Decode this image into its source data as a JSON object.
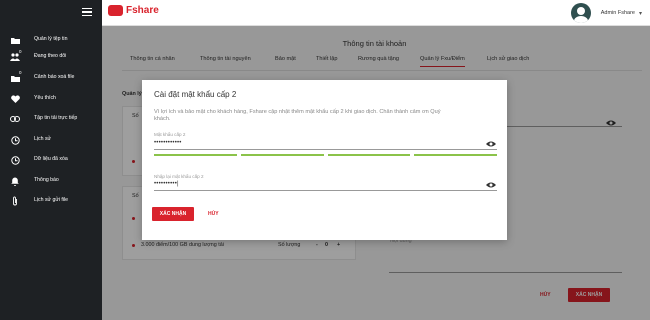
{
  "sidebar": {
    "items": [
      {
        "label": "Quản lý tệp tin",
        "icon": "folder-icon",
        "badge": ""
      },
      {
        "label": "Đang theo dõi",
        "icon": "people-icon",
        "badge": "0"
      },
      {
        "label": "Cảnh báo xoá file",
        "icon": "folder-warning-icon",
        "badge": "0"
      },
      {
        "label": "Yêu thích",
        "icon": "heart-icon",
        "badge": ""
      },
      {
        "label": "Tập tin tải trực tiếp",
        "icon": "link-icon",
        "badge": ""
      },
      {
        "label": "Lịch sử",
        "icon": "history-icon",
        "badge": ""
      },
      {
        "label": "Dữ liệu đã xóa",
        "icon": "trash-icon",
        "badge": ""
      },
      {
        "label": "Thông báo",
        "icon": "bell-icon",
        "badge": ""
      },
      {
        "label": "Lịch sử gửi file",
        "icon": "paperclip-icon",
        "badge": ""
      }
    ]
  },
  "header": {
    "logo": "Fshare",
    "user_name": "Admin Fshare",
    "avatar_caption": "Fshare"
  },
  "page": {
    "title": "Thông tin tài khoản",
    "tabs": [
      "Thông tin cá nhân",
      "Thông tin tài nguyên",
      "Bảo mật",
      "Thiết lập",
      "Rương quà tặng",
      "Quản lý Fxu/Điểm",
      "Lịch sử giao dịch"
    ],
    "active_tab": 5
  },
  "background": {
    "left_heading": "Quản lý",
    "row1_prefix": "Số",
    "row2_prefix": "Số",
    "item_text": "3.000 điểm/100 GB dung lượng tải",
    "quantity_label": "Số lượng",
    "quantity_value": "0",
    "minus": "-",
    "plus": "+",
    "notes_placeholder": "Nội dung",
    "cancel": "HỦY",
    "confirm": "XÁC NHẬN"
  },
  "modal": {
    "title": "Cài đặt mật khẩu cấp 2",
    "description": "Vì lợi ích và bảo mật cho khách hàng, Fshare cập nhật thêm mật khẩu cấp 2 khi giao dịch. Chân thành cảm ơn Quý khách.",
    "password_label": "Mật khẩu cấp 2",
    "password_value": "••••••••••••",
    "confirm_label": "Nhập lại mật khẩu cấp 2",
    "confirm_value": "••••••••••|",
    "confirm_button": "XÁC NHẬN",
    "cancel_button": "HỦY",
    "strength_fraction": 1.0
  },
  "colors": {
    "brand": "#d9232d",
    "sidebar": "#1e2124",
    "strength": "#8bc34a"
  }
}
